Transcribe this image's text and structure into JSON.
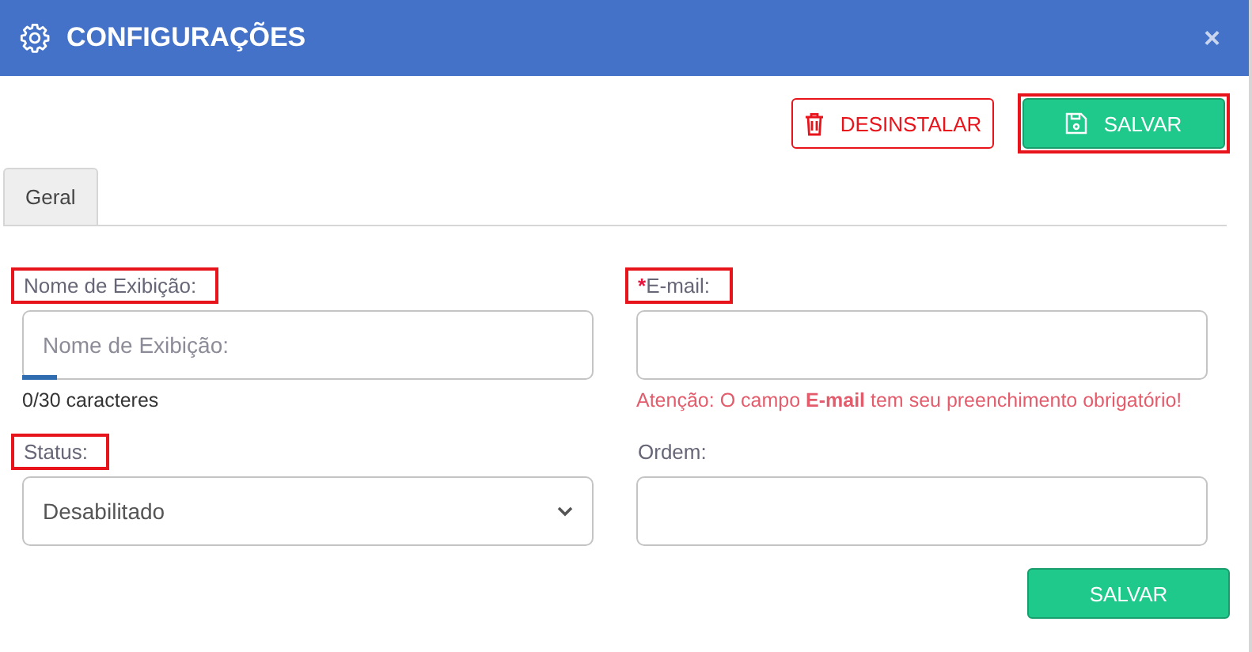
{
  "window": {
    "title": "CONFIGURAÇÕES",
    "close": "×"
  },
  "actions": [
    {
      "label": "DESINSTALAR",
      "kind": "danger",
      "highlighted": false
    },
    {
      "label": "SALVAR",
      "kind": "save",
      "highlighted": true
    }
  ],
  "tabs": [
    {
      "label": "Geral",
      "selected": true
    }
  ],
  "fields": [
    {
      "kind": "text",
      "label": "Nome de Exibição:",
      "highlighted": true,
      "placeholder": "Nome de Exibição:",
      "counter": "0/30 caracteres"
    },
    {
      "kind": "text",
      "label": "E-mail:",
      "required_mark": "*",
      "highlighted": true,
      "error": "Atenção: O campo **E-mail** tem seu preenchimento obrigatório!"
    },
    {
      "kind": "select",
      "label": "Status:",
      "highlighted": true,
      "value": "Desabilitado"
    },
    {
      "kind": "text",
      "label": "Ordem:",
      "highlighted": false
    }
  ],
  "footer_button": "SALVAR"
}
